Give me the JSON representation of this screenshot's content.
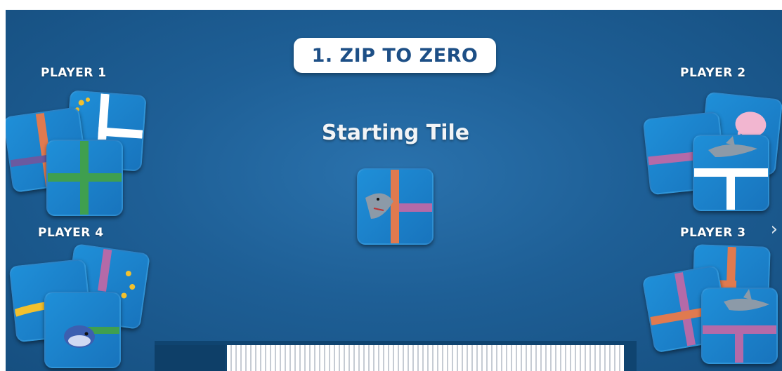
{
  "game": {
    "title": "1. ZIP TO ZERO",
    "center_label": "Starting Tile",
    "players": [
      {
        "label": "PLAYER 1"
      },
      {
        "label": "PLAYER 2"
      },
      {
        "label": "PLAYER 3"
      },
      {
        "label": "PLAYER 4"
      }
    ],
    "next_arrow": "›"
  },
  "colors": {
    "background": "#1e5f96",
    "tile": "#1874bd",
    "title_text": "#1d4f86",
    "pipe_orange": "#e07a4f",
    "pipe_pink": "#b46aa8",
    "pipe_green": "#3f9f4f",
    "pipe_white": "#ffffff",
    "pipe_yellow": "#f2c12e"
  },
  "icons": [
    "shark-icon",
    "whale-icon",
    "jellyfish-icon",
    "fish-school-icon",
    "chevron-right-icon"
  ]
}
